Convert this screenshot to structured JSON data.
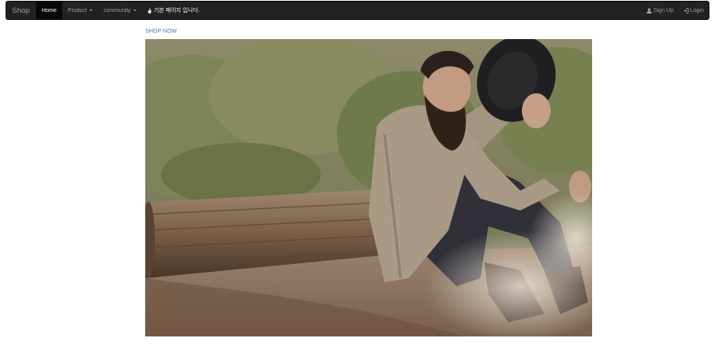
{
  "navbar": {
    "brand": "Shop",
    "items": [
      {
        "label": "Home",
        "active": true
      },
      {
        "label": "Product",
        "dropdown": true
      },
      {
        "label": "community",
        "dropdown": true
      }
    ],
    "notice": "기본 페이지 입니다.",
    "notice_icon": "fire-icon",
    "right": [
      {
        "label": "Sign Up",
        "icon": "user-icon"
      },
      {
        "label": "Login",
        "icon": "login-icon"
      }
    ]
  },
  "main": {
    "link_label": "SHOP NOW",
    "hero_image": "bearded man in knit cardigan sitting beside a log holding a black hat"
  },
  "colors": {
    "navbar_bg": "#222222",
    "navbar_active": "#080808",
    "link": "#337ab7"
  }
}
